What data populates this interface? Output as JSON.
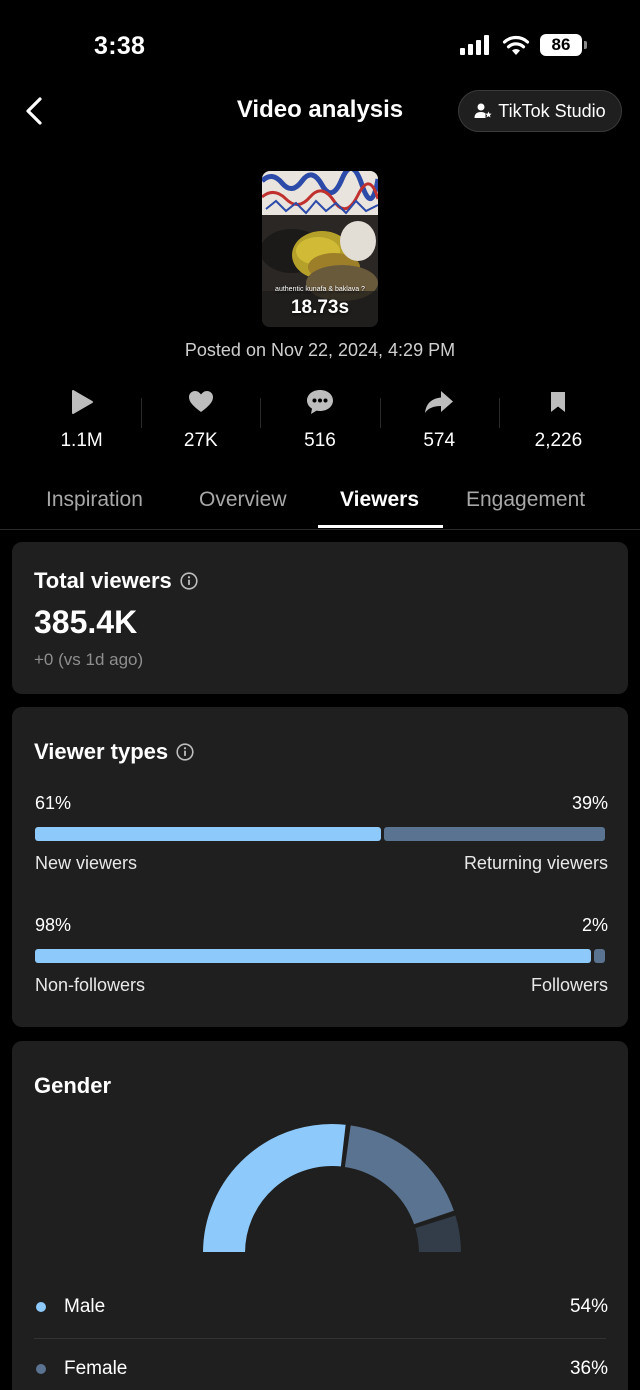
{
  "status_bar": {
    "time": "3:38",
    "battery": "86"
  },
  "header": {
    "title": "Video analysis",
    "studio_label": "TikTok Studio"
  },
  "video": {
    "caption": "authentic kunafa & baklava ?",
    "duration": "18.73s",
    "posted_on": "Posted on Nov 22, 2024, 4:29 PM"
  },
  "stats": [
    {
      "icon": "play-icon",
      "value": "1.1M"
    },
    {
      "icon": "heart-icon",
      "value": "27K"
    },
    {
      "icon": "comment-icon",
      "value": "516"
    },
    {
      "icon": "share-icon",
      "value": "574"
    },
    {
      "icon": "bookmark-icon",
      "value": "2,226"
    }
  ],
  "tabs": [
    {
      "label": "Inspiration",
      "active": false
    },
    {
      "label": "Overview",
      "active": false
    },
    {
      "label": "Viewers",
      "active": true
    },
    {
      "label": "Engagement",
      "active": false
    }
  ],
  "total_viewers": {
    "title": "Total viewers",
    "value": "385.4K",
    "change": "+0  (vs 1d ago)"
  },
  "viewer_types": {
    "title": "Viewer types",
    "rows": [
      {
        "left_pct": "61%",
        "right_pct": "39%",
        "left_label": "New viewers",
        "right_label": "Returning viewers",
        "left_value": 61,
        "right_value": 39
      },
      {
        "left_pct": "98%",
        "right_pct": "2%",
        "left_label": "Non-followers",
        "right_label": "Followers",
        "left_value": 98,
        "right_value": 2
      }
    ]
  },
  "gender": {
    "title": "Gender",
    "items": [
      {
        "name": "Male",
        "pct": "54%",
        "value": 54,
        "color": "#8ec9fb"
      },
      {
        "name": "Female",
        "pct": "36%",
        "value": 36,
        "color": "#5a7390"
      }
    ],
    "other_value": 10,
    "other_color": "#333d4a"
  },
  "colors": {
    "accent_blue": "#8ec9fb",
    "muted_blue": "#5a7390",
    "card_bg": "#1f1f1f"
  }
}
